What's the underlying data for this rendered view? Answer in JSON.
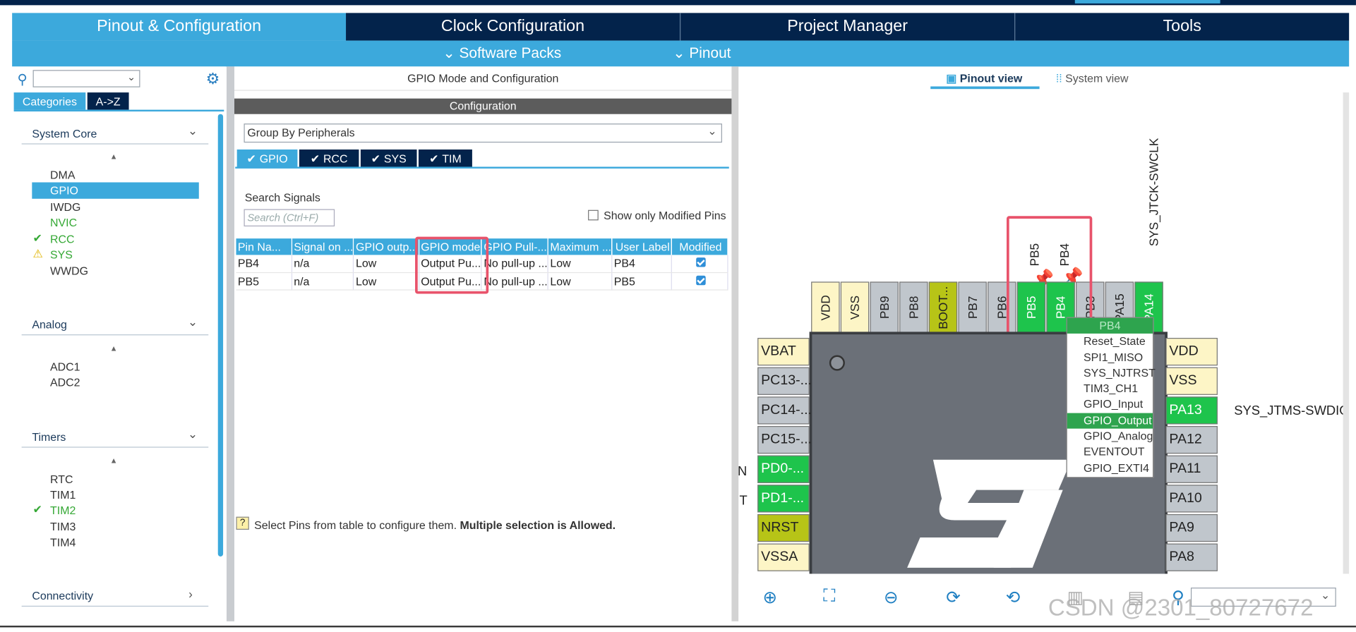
{
  "main_tabs": [
    "Pinout & Configuration",
    "Clock Configuration",
    "Project Manager",
    "Tools"
  ],
  "sub_menu": {
    "software_packs": "Software Packs",
    "pinout": "Pinout"
  },
  "left": {
    "cat_tabs": [
      "Categories",
      "A->Z"
    ],
    "groups": [
      {
        "name": "System Core",
        "items": [
          "DMA",
          "GPIO",
          "IWDG",
          "NVIC",
          "RCC",
          "SYS",
          "WWDG"
        ]
      },
      {
        "name": "Analog",
        "items": [
          "ADC1",
          "ADC2"
        ]
      },
      {
        "name": "Timers",
        "items": [
          "RTC",
          "TIM1",
          "TIM2",
          "TIM3",
          "TIM4"
        ]
      },
      {
        "name": "Connectivity",
        "items": []
      }
    ]
  },
  "middle": {
    "header": "GPIO Mode and Configuration",
    "config_label": "Configuration",
    "group_by": "Group By Peripherals",
    "periph_tabs": [
      "GPIO",
      "RCC",
      "SYS",
      "TIM"
    ],
    "search_label": "Search Signals",
    "search_placeholder": "Search (Ctrl+F)",
    "show_modified": "Show only Modified Pins",
    "columns": [
      "Pin Na...",
      "Signal on ...",
      "GPIO outp...",
      "GPIO mode",
      "GPIO Pull-...",
      "Maximum ...",
      "User Label",
      "Modified"
    ],
    "rows": [
      [
        "PB4",
        "n/a",
        "Low",
        "Output Pu...",
        "No pull-up ...",
        "Low",
        "PB4"
      ],
      [
        "PB5",
        "n/a",
        "Low",
        "Output Pu...",
        "No pull-up ...",
        "Low",
        "PB5"
      ]
    ],
    "hint_text": "Select Pins from table to configure them.",
    "hint_bold": "Multiple selection is Allowed."
  },
  "right": {
    "pinout_view": "Pinout view",
    "system_view": "System view",
    "top_labels": [
      "PB5",
      "PB4",
      "SYS_JTCK-SWCLK"
    ],
    "top_pins": [
      "VDD",
      "VSS",
      "PB9",
      "PB8",
      "BOOT...",
      "PB7",
      "PB6",
      "PB5",
      "PB4",
      "PB3",
      "PA15",
      "PA14"
    ],
    "left_pins": [
      "VBAT",
      "PC13-...",
      "PC14-...",
      "PC15-...",
      "PD0-...",
      "PD1-...",
      "NRST",
      "VSSA"
    ],
    "left_side_letters": [
      "N",
      "T"
    ],
    "right_pins": [
      "VDD",
      "VSS",
      "PA13",
      "PA12",
      "PA11",
      "PA10",
      "PA9",
      "PA8"
    ],
    "right_label": "SYS_JTMS-SWDIO",
    "context_menu": [
      "PB4",
      "Reset_State",
      "SPI1_MISO",
      "SYS_NJTRST",
      "TIM3_CH1",
      "GPIO_Input",
      "GPIO_Output",
      "GPIO_Analog",
      "EVENTOUT",
      "GPIO_EXTI4"
    ]
  },
  "watermark": "CSDN @2301_80727672",
  "colors": {
    "navy": "#03234b",
    "blue": "#3ca9dc",
    "green": "#1ec44c",
    "highlight": "#e8536b"
  }
}
